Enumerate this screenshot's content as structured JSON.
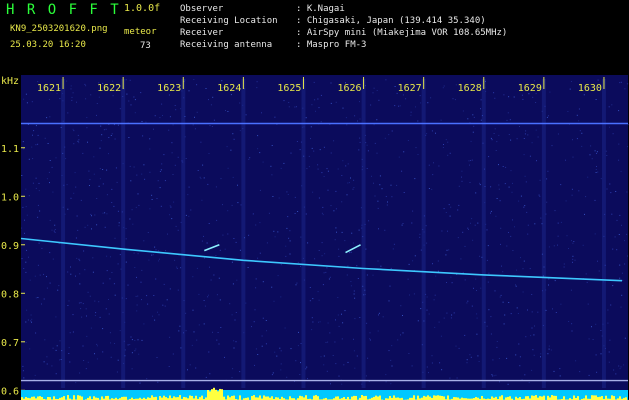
{
  "header": {
    "brand": "H R O F F T",
    "version": "1.0.0f",
    "filename": "KN9_2503201620.png",
    "datetime": "25.03.20 16:20",
    "meteor_label": "meteor",
    "meteor_count": "73",
    "info": [
      {
        "key": "Observer",
        "value": "K.Nagai"
      },
      {
        "key": "Receiving Location",
        "value": "Chigasaki, Japan (139.414 35.340)"
      },
      {
        "key": "Receiver",
        "value": "AirSpy mini (Miakejima VOR 108.65MHz)"
      },
      {
        "key": "Receiving antenna",
        "value": "Maspro FM-3"
      }
    ]
  },
  "chart_data": {
    "type": "line",
    "ylabel": "kHz",
    "x_ticks": [
      "1621",
      "1622",
      "1623",
      "1624",
      "1625",
      "1626",
      "1627",
      "1628",
      "1629",
      "1630"
    ],
    "y_ticks": [
      0.6,
      0.7,
      0.8,
      0.9,
      1.0,
      1.1
    ],
    "xlim": [
      1620.3,
      1630.4
    ],
    "ylim": [
      0.58,
      1.25
    ],
    "series": [
      {
        "x": [
          1620.3,
          1622.0,
          1624.0,
          1626.0,
          1628.0,
          1630.3
        ],
        "y": [
          0.913,
          0.891,
          0.868,
          0.851,
          0.838,
          0.826
        ]
      }
    ],
    "lines": [
      {
        "y": 1.15
      },
      {
        "y": 0.62
      }
    ],
    "meteor_echoes": [
      {
        "x": [
          1623.35,
          1623.6
        ],
        "y": [
          0.888,
          0.9
        ]
      },
      {
        "x": [
          1625.7,
          1625.95
        ],
        "y": [
          0.884,
          0.9
        ]
      }
    ],
    "colors": {
      "background": "#0b0b5c",
      "trace": "#3dc8ff",
      "axis_text": "#e8e84a",
      "header_text": "#2bff3a",
      "activity_bar": "#00c8ff",
      "activity_spikes": "#ffff40"
    }
  }
}
